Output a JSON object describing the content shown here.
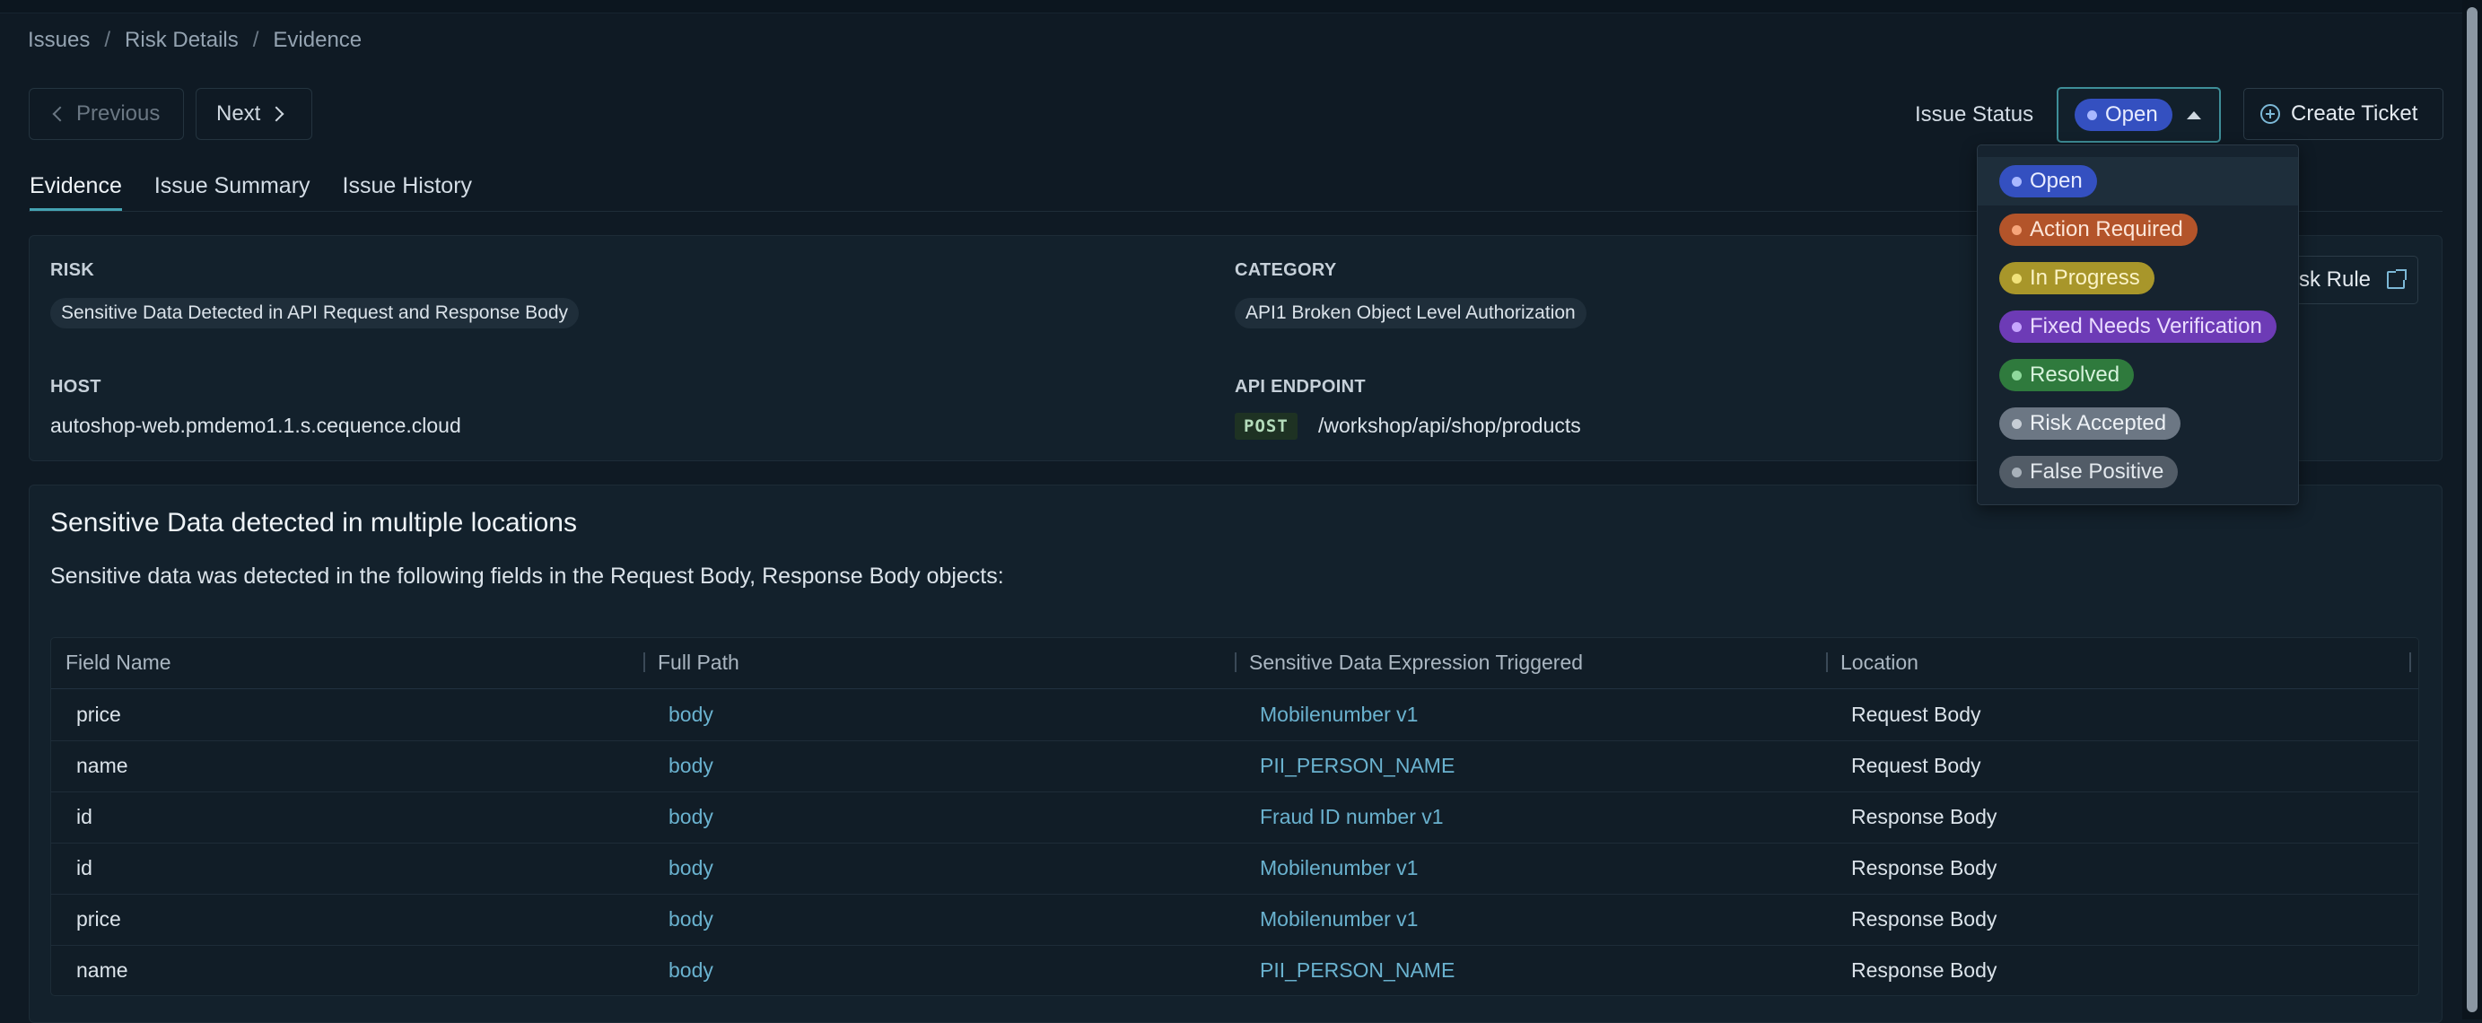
{
  "breadcrumb": [
    "Issues",
    "Risk Details",
    "Evidence"
  ],
  "nav": {
    "previous": "Previous",
    "next": "Next"
  },
  "status": {
    "label": "Issue Status",
    "selected": "Open",
    "options": [
      "Open",
      "Action Required",
      "In Progress",
      "Fixed Needs Verification",
      "Resolved",
      "Risk Accepted",
      "False Positive"
    ]
  },
  "create_ticket": "Create Ticket",
  "risk_rule": "sk Rule",
  "tabs": [
    "Evidence",
    "Issue Summary",
    "Issue History"
  ],
  "details": {
    "risk_label": "RISK",
    "risk_value": "Sensitive Data Detected in API Request and Response Body",
    "category_label": "CATEGORY",
    "category_value": "API1 Broken Object Level Authorization",
    "host_label": "HOST",
    "host_value": "autoshop-web.pmdemo1.1.s.cequence.cloud",
    "endpoint_label": "API ENDPOINT",
    "endpoint_method": "POST",
    "endpoint_path": "/workshop/api/shop/products"
  },
  "section": {
    "title": "Sensitive Data detected in multiple locations",
    "description": "Sensitive data was detected in the following fields in the Request Body, Response Body objects:"
  },
  "table": {
    "columns": [
      "Field Name",
      "Full Path",
      "Sensitive Data Expression Triggered",
      "Location"
    ],
    "rows": [
      [
        "price",
        "body",
        "Mobilenumber v1",
        "Request Body"
      ],
      [
        "name",
        "body",
        "PII_PERSON_NAME",
        "Request Body"
      ],
      [
        "id",
        "body",
        "Fraud ID number v1",
        "Response Body"
      ],
      [
        "id",
        "body",
        "Mobilenumber v1",
        "Response Body"
      ],
      [
        "price",
        "body",
        "Mobilenumber v1",
        "Response Body"
      ],
      [
        "name",
        "body",
        "PII_PERSON_NAME",
        "Response Body"
      ]
    ]
  }
}
